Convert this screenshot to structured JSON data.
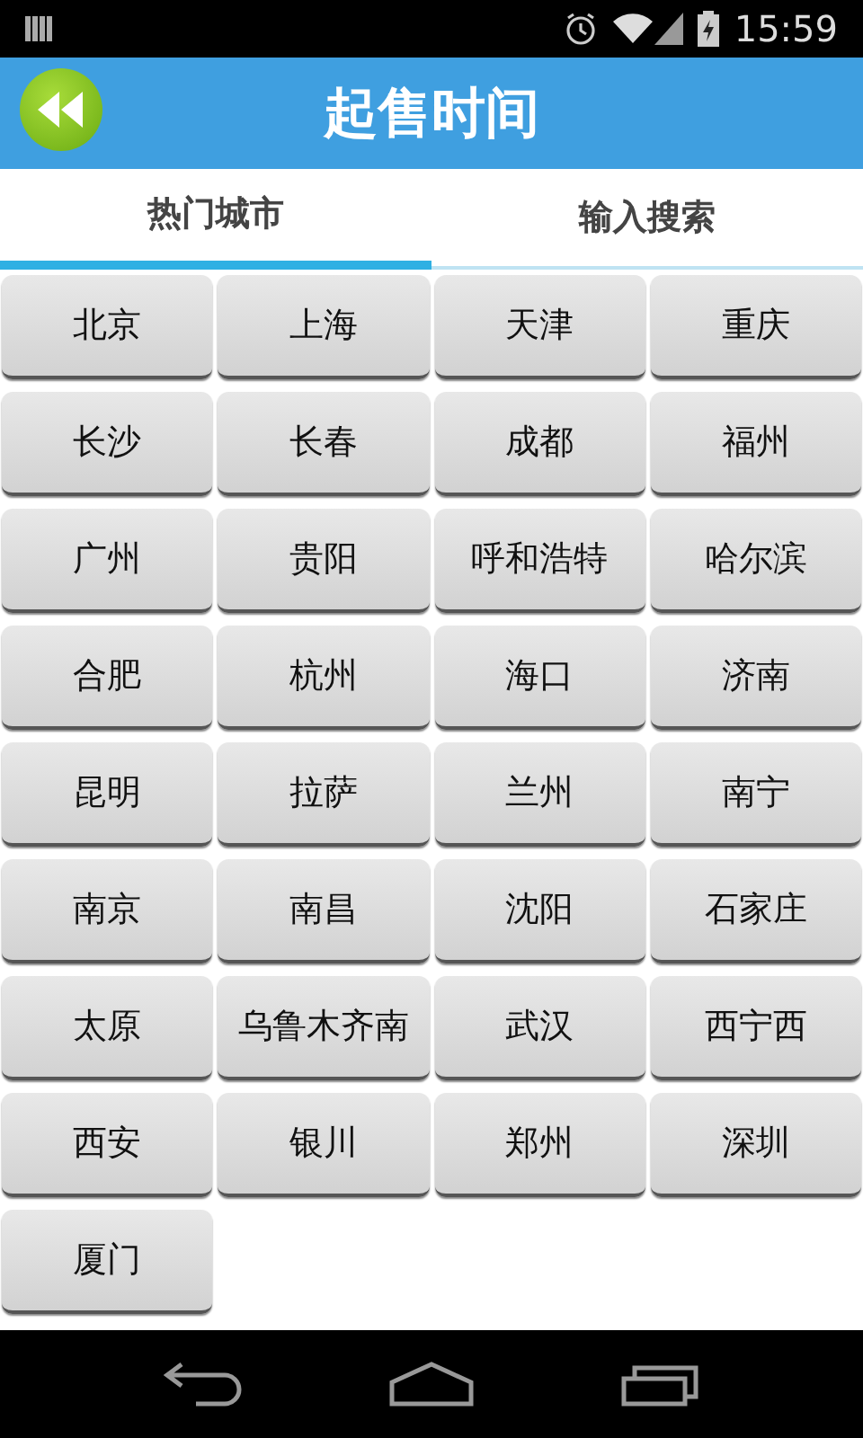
{
  "status_bar": {
    "time": "15:59"
  },
  "header": {
    "title": "起售时间"
  },
  "tabs": [
    {
      "label": "热门城市",
      "selected": true
    },
    {
      "label": "输入搜索",
      "selected": false
    }
  ],
  "cities": [
    "北京",
    "上海",
    "天津",
    "重庆",
    "长沙",
    "长春",
    "成都",
    "福州",
    "广州",
    "贵阳",
    "呼和浩特",
    "哈尔滨",
    "合肥",
    "杭州",
    "海口",
    "济南",
    "昆明",
    "拉萨",
    "兰州",
    "南宁",
    "南京",
    "南昌",
    "沈阳",
    "石家庄",
    "太原",
    "乌鲁木齐南",
    "武汉",
    "西宁西",
    "西安",
    "银川",
    "郑州",
    "深圳",
    "厦门"
  ]
}
